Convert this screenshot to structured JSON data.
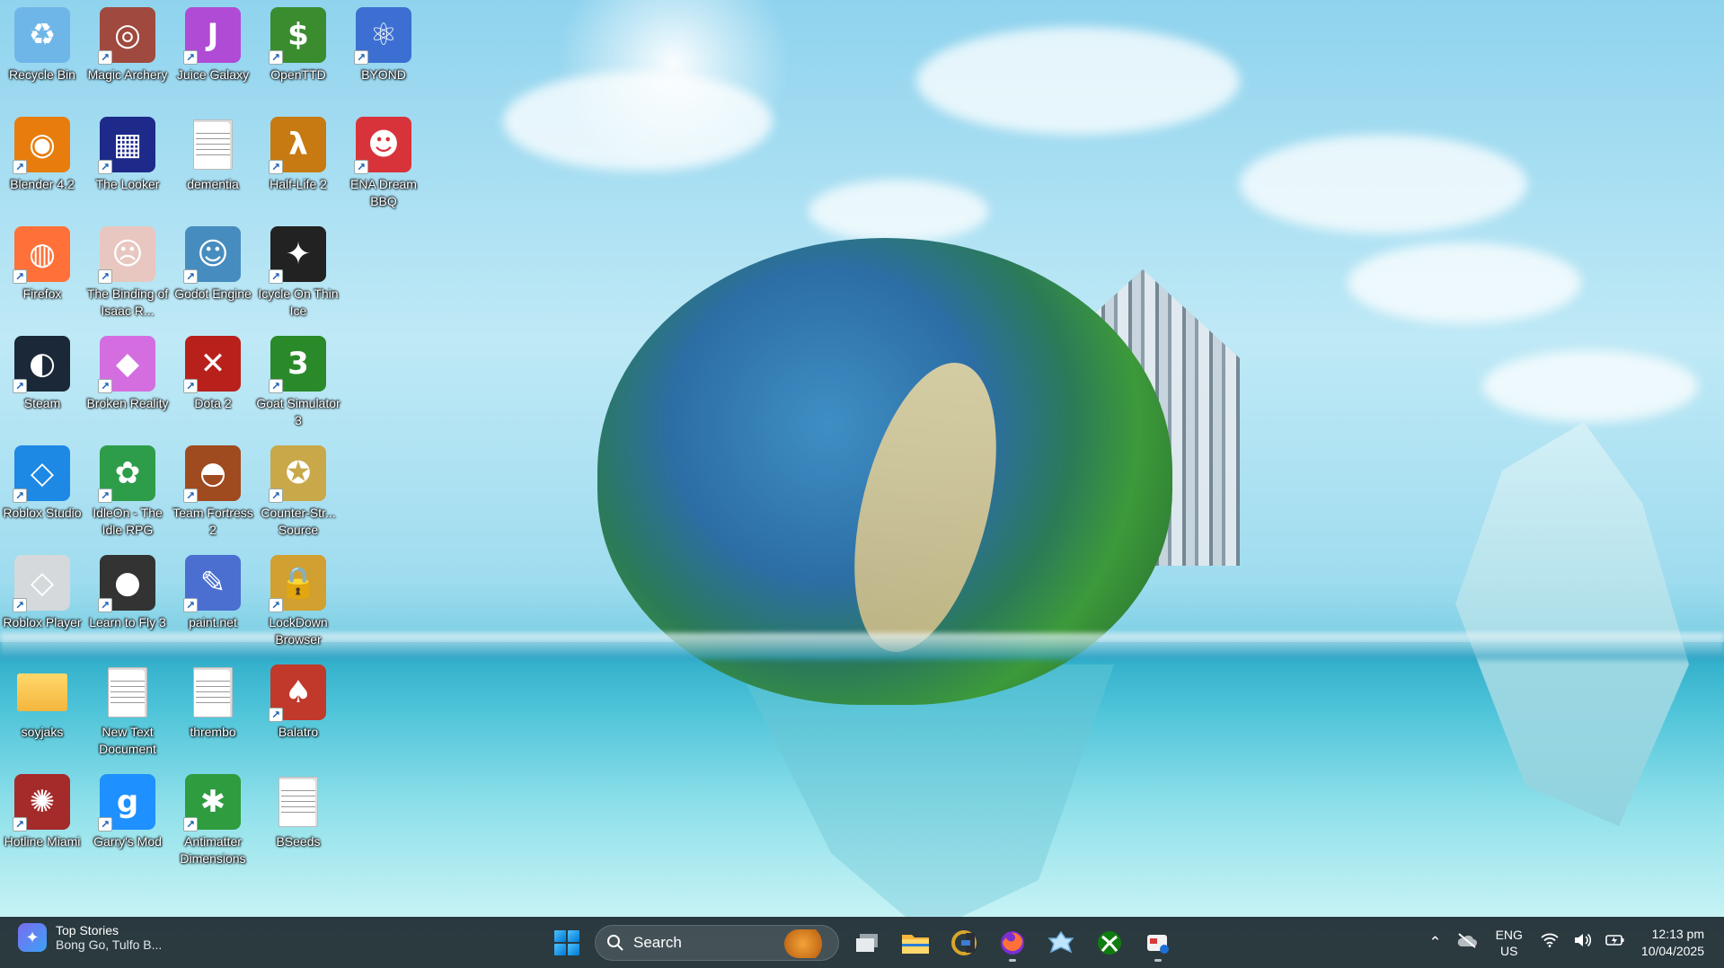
{
  "desktop": {
    "icons": [
      {
        "label": "Recycle Bin",
        "glyph": "♻",
        "color": "#6fb6e8",
        "shortcut": false
      },
      {
        "label": "Magic Archery",
        "glyph": "◎",
        "color": "#a0493f",
        "shortcut": true
      },
      {
        "label": "Juice Galaxy",
        "glyph": "J",
        "color": "#b04bd6",
        "shortcut": true
      },
      {
        "label": "OpenTTD",
        "glyph": "$",
        "color": "#3a8c2f",
        "shortcut": true
      },
      {
        "label": "BYOND",
        "glyph": "⚛",
        "color": "#3c6fd1",
        "shortcut": true
      },
      {
        "label": "Blender 4.2",
        "glyph": "◉",
        "color": "#e87d0d",
        "shortcut": true
      },
      {
        "label": "The Looker",
        "glyph": "▦",
        "color": "#1d2a8a",
        "shortcut": true
      },
      {
        "label": "dementia",
        "glyph": "",
        "color": "doc",
        "shortcut": false
      },
      {
        "label": "Half-Life 2",
        "glyph": "λ",
        "color": "#c77a12",
        "shortcut": true
      },
      {
        "label": "ENA Dream BBQ",
        "glyph": "☻",
        "color": "#d8333a",
        "shortcut": true
      },
      {
        "label": "Firefox",
        "glyph": "◍",
        "color": "#ff7139",
        "shortcut": true
      },
      {
        "label": "The Binding of Isaac R...",
        "glyph": "☹",
        "color": "#e8c7c0",
        "shortcut": true
      },
      {
        "label": "Godot Engine",
        "glyph": "☺",
        "color": "#478cbf",
        "shortcut": true
      },
      {
        "label": "Icycle On Thin Ice",
        "glyph": "✦",
        "color": "#222222",
        "shortcut": true
      },
      {
        "label": "Steam",
        "glyph": "◐",
        "color": "#1b2838",
        "shortcut": true
      },
      {
        "label": "Broken Reality",
        "glyph": "◆",
        "color": "#d46ee0",
        "shortcut": true
      },
      {
        "label": "Dota 2",
        "glyph": "✕",
        "color": "#b8211b",
        "shortcut": true
      },
      {
        "label": "Goat Simulator 3",
        "glyph": "3",
        "color": "#2a8a2a",
        "shortcut": true
      },
      {
        "label": "Roblox Studio",
        "glyph": "◇",
        "color": "#1e88e5",
        "shortcut": true
      },
      {
        "label": "IdleOn - The Idle RPG",
        "glyph": "✿",
        "color": "#2e9d4a",
        "shortcut": true
      },
      {
        "label": "Team Fortress 2",
        "glyph": "◓",
        "color": "#a04a20",
        "shortcut": true
      },
      {
        "label": "Counter-Str... Source",
        "glyph": "✪",
        "color": "#c9a84a",
        "shortcut": true
      },
      {
        "label": "Roblox Player",
        "glyph": "◇",
        "color": "#d5d9dc",
        "shortcut": true
      },
      {
        "label": "Learn to Fly 3",
        "glyph": "●",
        "color": "#333333",
        "shortcut": true
      },
      {
        "label": "paint.net",
        "glyph": "✎",
        "color": "#4a6fd0",
        "shortcut": true
      },
      {
        "label": "LockDown Browser",
        "glyph": "🔒",
        "color": "#d2a030",
        "shortcut": true
      },
      {
        "label": "soyjaks",
        "glyph": "",
        "color": "folder",
        "shortcut": false
      },
      {
        "label": "New Text Document",
        "glyph": "",
        "color": "doc",
        "shortcut": false
      },
      {
        "label": "thrembo",
        "glyph": "",
        "color": "doc",
        "shortcut": false
      },
      {
        "label": "Balatro",
        "glyph": "♠",
        "color": "#c0392b",
        "shortcut": true
      },
      {
        "label": "Hotline Miami",
        "glyph": "✺",
        "color": "#a52a2a",
        "shortcut": true
      },
      {
        "label": "Garry's Mod",
        "glyph": "g",
        "color": "#1e90ff",
        "shortcut": true
      },
      {
        "label": "Antimatter Dimensions",
        "glyph": "✱",
        "color": "#2e9c3f",
        "shortcut": true
      },
      {
        "label": "BSeeds",
        "glyph": "",
        "color": "doc",
        "shortcut": false
      }
    ]
  },
  "taskbar": {
    "news_title": "Top Stories",
    "news_subtitle": "Bong Go, Tulfo B...",
    "search_placeholder": "Search",
    "tray": {
      "lang_line1": "ENG",
      "lang_line2": "US",
      "time": "12:13 pm",
      "date": "10/04/2025"
    }
  }
}
